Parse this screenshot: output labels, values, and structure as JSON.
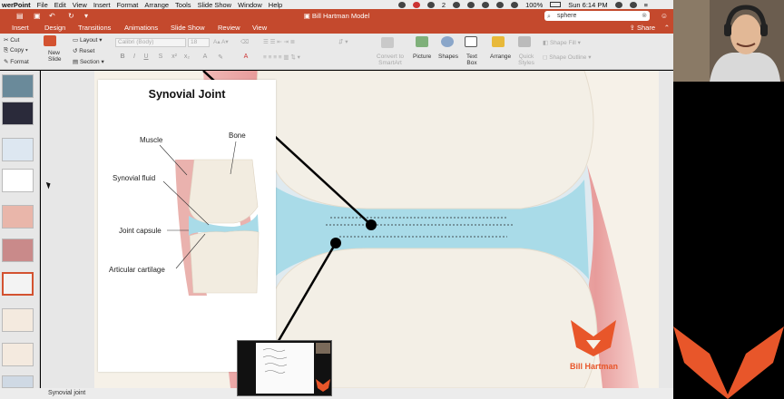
{
  "menubar": {
    "app": "werPoint",
    "items": [
      "File",
      "Edit",
      "View",
      "Insert",
      "Format",
      "Arrange",
      "Tools",
      "Slide Show",
      "Window",
      "Help"
    ],
    "badge_count": "2",
    "battery": "100%",
    "clock": "Sun 6:14 PM"
  },
  "titlebar": {
    "document_title": "Bill Hartman Model",
    "search_value": "sphere"
  },
  "tabs": [
    "Insert",
    "Design",
    "Transitions",
    "Animations",
    "Slide Show",
    "Review",
    "View"
  ],
  "share_label": "Share",
  "ribbon": {
    "cut": "Cut",
    "copy": "Copy",
    "format": "Format",
    "new_slide": "New Slide",
    "layout": "Layout",
    "reset": "Reset",
    "section": "Section",
    "font_name": "Calibri (Body)",
    "font_size": "18",
    "convert_smartart": "Convert to SmartArt",
    "picture": "Picture",
    "shapes": "Shapes",
    "text_box": "Text Box",
    "arrange": "Arrange",
    "quick_styles": "Quick Styles",
    "shape_fill": "Shape Fill",
    "shape_outline": "Shape Outline"
  },
  "inset": {
    "title": "Synovial Joint",
    "labels": {
      "muscle": "Muscle",
      "bone": "Bone",
      "synovial_fluid": "Synovial fluid",
      "joint_capsule": "Joint capsule",
      "articular_cartilage": "Articular cartilage"
    }
  },
  "logo_text": "Bill Hartman",
  "notes_text": "Synovial joint",
  "colors": {
    "accent": "#c4492d",
    "fluid": "#a9dbe8",
    "bone": "#f3efe6",
    "muscle": "#e9a9a9",
    "logo_orange": "#e8562a"
  }
}
